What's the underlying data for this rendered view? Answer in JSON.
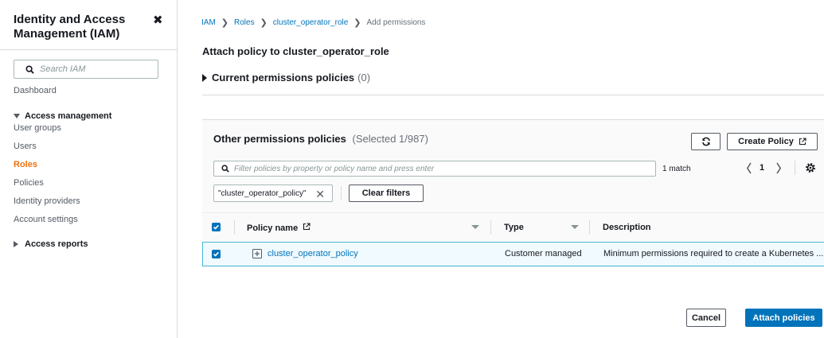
{
  "sidebar": {
    "title": "Identity and Access Management (IAM)",
    "close_glyph": "✖",
    "search_placeholder": "Search IAM",
    "dashboard": "Dashboard",
    "access_management": "Access management",
    "items": [
      {
        "label": "User groups"
      },
      {
        "label": "Users"
      },
      {
        "label": "Roles"
      },
      {
        "label": "Policies"
      },
      {
        "label": "Identity providers"
      },
      {
        "label": "Account settings"
      }
    ],
    "access_reports": "Access reports"
  },
  "breadcrumb": {
    "iam": "IAM",
    "roles": "Roles",
    "role": "cluster_operator_role",
    "current": "Add permissions"
  },
  "page": {
    "title": "Attach policy to cluster_operator_role",
    "current_policies_label": "Current permissions policies",
    "current_policies_count": "(0)"
  },
  "panel": {
    "title": "Other permissions policies",
    "selected": "(Selected 1/987)",
    "create_policy": "Create Policy",
    "filter_placeholder": "Filter policies by property or policy name and press enter",
    "match": "1 match",
    "page": "1",
    "token": "\"cluster_operator_policy\"",
    "clear_filters": "Clear filters",
    "columns": {
      "policy_name": "Policy name",
      "type": "Type",
      "description": "Description"
    },
    "rows": [
      {
        "name": "cluster_operator_policy",
        "type": "Customer managed",
        "description": "Minimum permissions required to create a Kubernetes ..."
      }
    ]
  },
  "footer": {
    "cancel": "Cancel",
    "attach": "Attach policies"
  },
  "colors": {
    "link": "#0073bb",
    "active": "#ec7211",
    "primary": "#0073bb"
  }
}
